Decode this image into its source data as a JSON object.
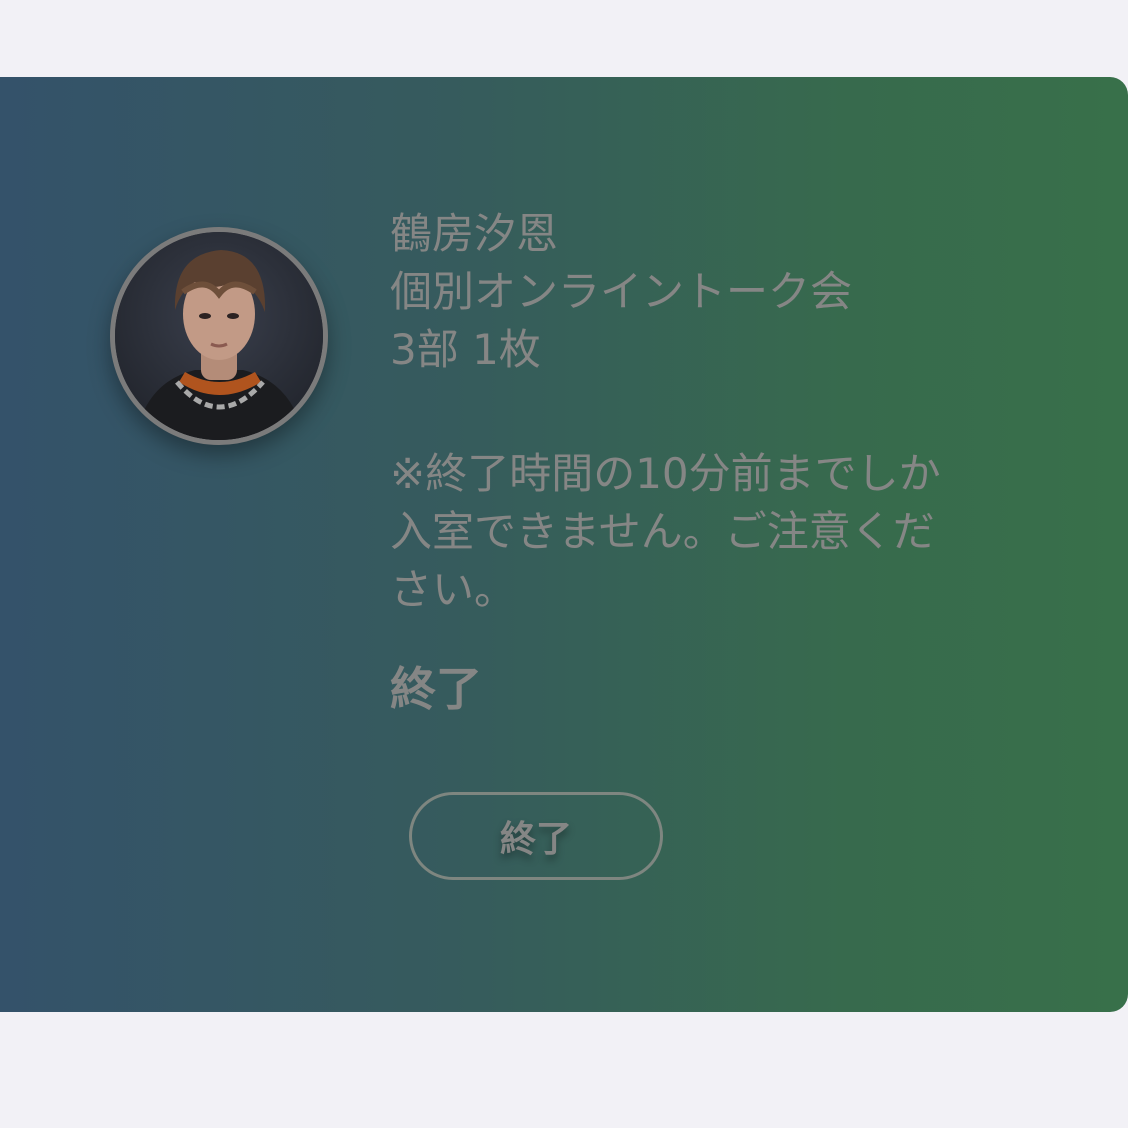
{
  "ticket": {
    "artist_name": "鶴房汐恩",
    "event_name": "個別オンライントーク会",
    "session_info": "3部 1枚",
    "notice": "※終了時間の10分前までしか入室できません。ご注意ください。",
    "status": "終了",
    "button_label": "終了"
  },
  "colors": {
    "background": "#f2f1f6",
    "card_gradient_start": "#34526a",
    "card_gradient_end": "#38704a",
    "text": "#858685"
  },
  "icons": {
    "avatar": "profile-photo"
  }
}
